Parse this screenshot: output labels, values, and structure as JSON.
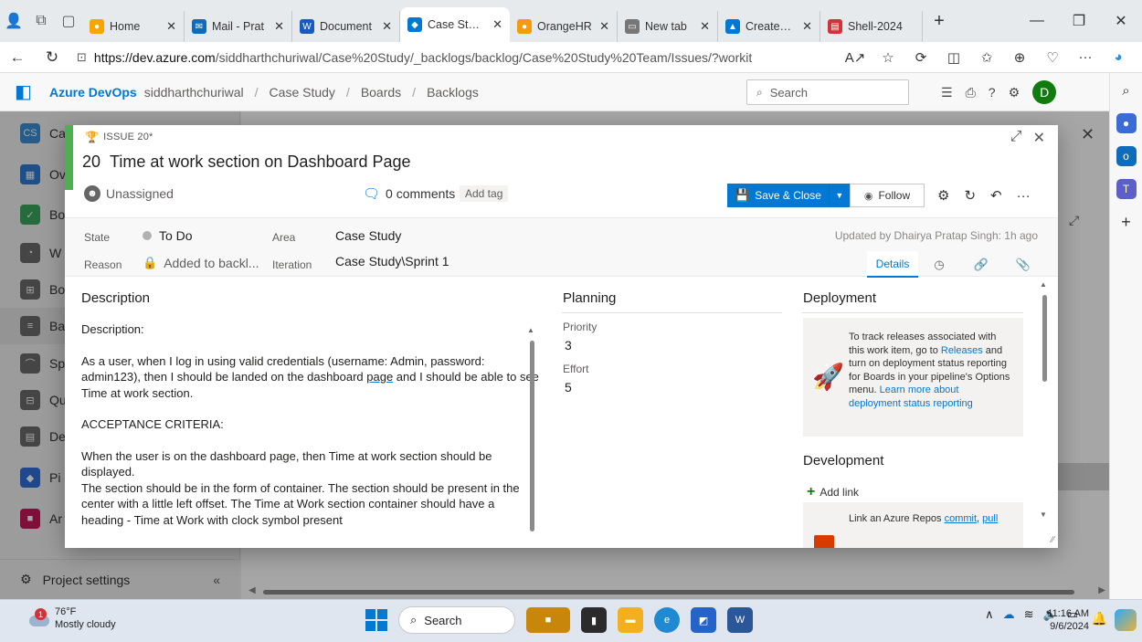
{
  "browser": {
    "tabs": [
      {
        "label": "Home",
        "color": "#f7a600",
        "glyph": "●"
      },
      {
        "label": "Mail - Prat",
        "color": "#0f6cbd",
        "glyph": "✉"
      },
      {
        "label": "Document",
        "color": "#185abd",
        "glyph": "W"
      },
      {
        "label": "Case Study",
        "color": "#0078d4",
        "glyph": "◆"
      },
      {
        "label": "OrangeHR",
        "color": "#f39c12",
        "glyph": "●"
      },
      {
        "label": "New tab",
        "color": "#777777",
        "glyph": "▭"
      },
      {
        "label": "CreateVm",
        "color": "#0078d4",
        "glyph": "▲"
      },
      {
        "label": "Shell-2024",
        "color": "#d13438",
        "glyph": "▤"
      }
    ],
    "url_host": "https://dev.azure.com",
    "url_path": "/siddharthchuriwal/Case%20Study/_backlogs/backlog/Case%20Study%20Team/Issues/?workit...",
    "profile_initial": "D"
  },
  "ado": {
    "brand": "Azure DevOps",
    "breadcrumbs": [
      "siddharthchuriwal",
      "Case Study",
      "Boards",
      "Backlogs"
    ],
    "search_placeholder": "Search",
    "avatar": "D",
    "nav": [
      {
        "abbr": "CS",
        "label": "Ca",
        "color": "#3a8ed4"
      },
      {
        "abbr": "▦",
        "label": "Ov",
        "color": "#2e7bcf"
      },
      {
        "abbr": "✓",
        "label": "Bo",
        "color": "#3aa55d"
      },
      {
        "abbr": "◔",
        "label": "W",
        "color": "#6b6b6b"
      },
      {
        "abbr": "⊞",
        "label": "Bo",
        "color": "#6b6b6b"
      },
      {
        "abbr": "≡",
        "label": "Ba",
        "color": "#6b6b6b"
      },
      {
        "abbr": "⌒",
        "label": "Sp",
        "color": "#6b6b6b"
      },
      {
        "abbr": "⊟",
        "label": "Qu",
        "color": "#6b6b6b"
      },
      {
        "abbr": "▤",
        "label": "De",
        "color": "#6b6b6b"
      },
      {
        "abbr": "◆",
        "label": "Pi",
        "color": "#2f6fd6"
      },
      {
        "abbr": "■",
        "label": "Ar",
        "color": "#c2185b"
      }
    ],
    "project_settings": "Project settings"
  },
  "work_item": {
    "type_label": "ISSUE 20*",
    "number": "20",
    "title": "Time at work section on Dashboard Page",
    "assignee": "Unassigned",
    "comments": "0 comments",
    "add_tag": "Add tag",
    "save_close": "Save & Close",
    "follow": "Follow",
    "fields": {
      "state_label": "State",
      "state_value": "To Do",
      "reason_label": "Reason",
      "reason_value": "Added to backl...",
      "area_label": "Area",
      "area_value": "Case Study",
      "iteration_label": "Iteration",
      "iteration_value": "Case Study\\Sprint 1"
    },
    "updated": "Updated by Dhairya Pratap Singh: 1h ago",
    "details_tab": "Details",
    "description": {
      "heading": "Description",
      "p1": "Description:",
      "p2a": "As a user, when I log in using valid credentials (username: Admin, password: admin123), then I should be landed on the dashboard ",
      "p2_link": "page",
      "p2b": " and I should be able to see Time at work section.",
      "p3": "ACCEPTANCE CRITERIA:",
      "p4": "When the user is on the dashboard page, then Time at work section should be displayed.",
      "p5": "The section should be in the form of container. The section should be present in the center with a little left offset. The Time at Work section container should have a heading - Time at Work with clock symbol present"
    },
    "planning": {
      "heading": "Planning",
      "priority_label": "Priority",
      "priority_value": "3",
      "effort_label": "Effort",
      "effort_value": "5"
    },
    "deployment": {
      "heading": "Deployment",
      "t1": "To track releases associated with this work item, go to ",
      "releases_link": "Releases",
      "t2": " and turn on deployment status reporting for Boards in your pipeline's Options menu. ",
      "learn_link": "Learn more about deployment status reporting"
    },
    "development": {
      "heading": "Development",
      "add_link": "Add link",
      "text_a": "Link an Azure Repos ",
      "commit_link": "commit",
      "pull_link": "pull"
    }
  },
  "taskbar": {
    "temperature": "76°F",
    "weather": "Mostly cloudy",
    "weather_badge": "1",
    "search": "Search",
    "time": "11:16 AM",
    "date": "9/6/2024"
  }
}
